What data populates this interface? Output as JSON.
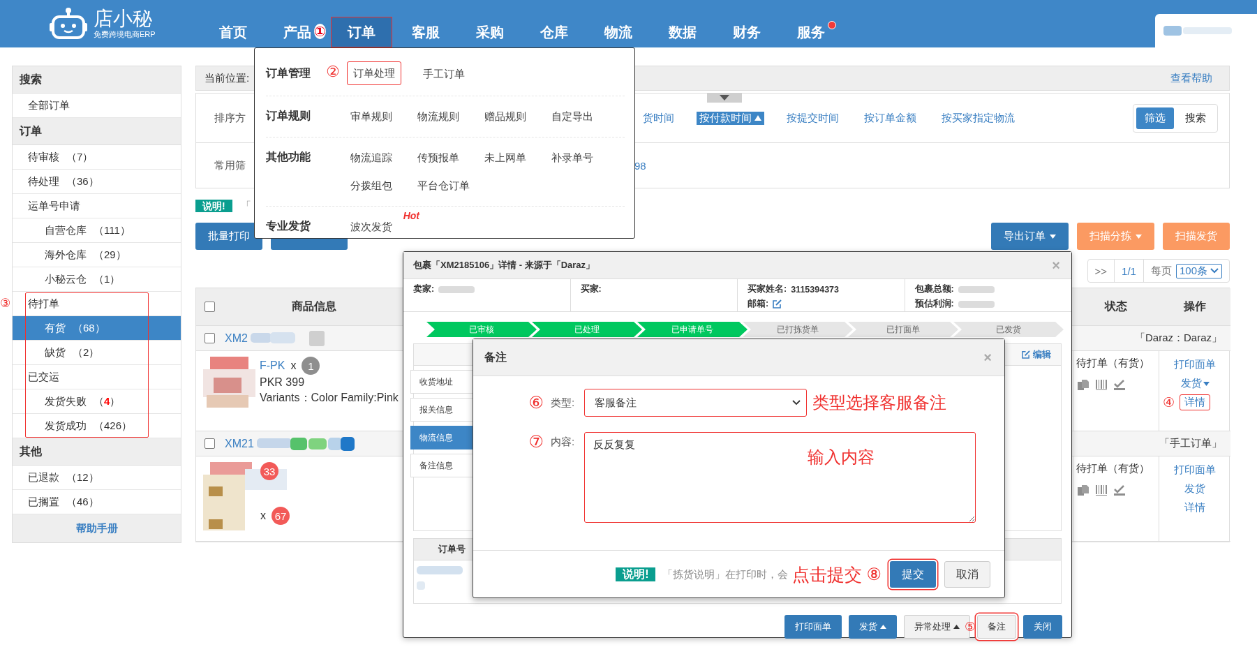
{
  "header": {
    "logo": {
      "name": "店小秘",
      "tagline": "免费跨境电商ERP"
    },
    "nav": [
      {
        "label": "首页",
        "selected": false,
        "highlighted": false,
        "notify": false
      },
      {
        "label": "产品",
        "selected": false,
        "highlighted": false,
        "notify": false
      },
      {
        "label": "订单",
        "selected": true,
        "highlighted": true,
        "notify": false,
        "marker": "①"
      },
      {
        "label": "客服",
        "selected": false,
        "highlighted": false,
        "notify": false
      },
      {
        "label": "采购",
        "selected": false,
        "highlighted": false,
        "notify": false
      },
      {
        "label": "仓库",
        "selected": false,
        "highlighted": false,
        "notify": false
      },
      {
        "label": "物流",
        "selected": false,
        "highlighted": false,
        "notify": false
      },
      {
        "label": "数据",
        "selected": false,
        "highlighted": false,
        "notify": false
      },
      {
        "label": "财务",
        "selected": false,
        "highlighted": false,
        "notify": false
      },
      {
        "label": "服务",
        "selected": false,
        "highlighted": false,
        "notify": true
      }
    ]
  },
  "menu": {
    "sections": [
      {
        "title": "订单管理",
        "links": [
          {
            "label": "订单处理",
            "highlighted": true,
            "marker": "②"
          },
          {
            "label": "手工订单",
            "highlighted": false
          }
        ]
      },
      {
        "title": "订单规则",
        "links": [
          {
            "label": "审单规则",
            "highlighted": false
          },
          {
            "label": "物流规则",
            "highlighted": false
          },
          {
            "label": "赠品规则",
            "highlighted": false
          },
          {
            "label": "自定导出",
            "highlighted": false
          }
        ]
      },
      {
        "title": "其他功能",
        "links": [
          {
            "label": "物流追踪",
            "highlighted": false
          },
          {
            "label": "传预报单",
            "highlighted": false
          },
          {
            "label": "未上网单",
            "highlighted": false
          },
          {
            "label": "补录单号",
            "highlighted": false
          },
          {
            "label": "分拨组包",
            "highlighted": false
          },
          {
            "label": "平台仓订单",
            "highlighted": false
          }
        ]
      },
      {
        "title": "专业发货",
        "links": [
          {
            "label": "波次发货",
            "highlighted": false,
            "tag": "Hot"
          }
        ]
      }
    ]
  },
  "sidebar": {
    "sections": [
      {
        "title": "搜索",
        "items": [
          {
            "kind": "entry",
            "label": "全部订单",
            "selected": false
          }
        ]
      },
      {
        "title": "订单",
        "items": [
          {
            "kind": "entry",
            "label": "待审核",
            "count": "（7）",
            "alert": false,
            "selected": false
          },
          {
            "kind": "entry",
            "label": "待处理",
            "count": "（36）",
            "alert": false,
            "selected": false
          },
          {
            "kind": "entry",
            "label": "运单号申请",
            "selected": false,
            "children": [
              {
                "kind": "entry",
                "label": "自营仓库",
                "count": "（111）",
                "alert": false,
                "selected": false
              },
              {
                "kind": "entry",
                "label": "海外仓库",
                "count": "（29）",
                "alert": false,
                "selected": false
              },
              {
                "kind": "entry",
                "label": "小秘云仓",
                "count": "（1）",
                "alert": false,
                "selected": false
              }
            ]
          },
          {
            "kind": "annotation",
            "marker": "③",
            "items": [
              {
                "kind": "entry",
                "label": "待打单",
                "selected": false,
                "children": [
                  {
                    "kind": "entry",
                    "label": "有货",
                    "count": "（68）",
                    "alert": false,
                    "selected": true
                  },
                  {
                    "kind": "entry",
                    "label": "缺货",
                    "count": "（2）",
                    "alert": false,
                    "selected": false
                  }
                ]
              },
              {
                "kind": "entry",
                "label": "已交运",
                "selected": false,
                "children": [
                  {
                    "kind": "entry",
                    "label": "发货失败",
                    "count": "（4）",
                    "alert": true,
                    "selected": false
                  },
                  {
                    "kind": "entry",
                    "label": "发货成功",
                    "count": "（426）",
                    "alert": false,
                    "selected": false
                  }
                ]
              }
            ]
          }
        ]
      },
      {
        "title": "其他",
        "items": [
          {
            "kind": "entry",
            "label": "已退款",
            "count": "（12）",
            "alert": false,
            "selected": false
          },
          {
            "kind": "entry",
            "label": "已搁置",
            "count": "（46）",
            "alert": false,
            "selected": false
          }
        ]
      }
    ],
    "footer": "帮助手册"
  },
  "content": {
    "breadcrumb": "当前位置:",
    "help": "查看帮助",
    "sort_label": "排序方",
    "sort_options": [
      {
        "label": "货时间",
        "selected": false
      },
      {
        "label": "按付款时间",
        "selected": true
      },
      {
        "label": "按提交时间",
        "selected": false
      },
      {
        "label": "按订单金额",
        "selected": false
      },
      {
        "label": "按买家指定物流",
        "selected": false
      }
    ],
    "view_toggle": [
      {
        "label": "筛选",
        "selected": true
      },
      {
        "label": "搜索",
        "selected": false
      }
    ],
    "filter_label": "常用筛",
    "filter_value": "98",
    "notice_label": "说明!",
    "notice_text": "「",
    "left_buttons": [
      {
        "label": "批量打印"
      }
    ],
    "right_buttons": [
      {
        "label": "导出订单",
        "color": "#337ab7",
        "caret": true
      },
      {
        "label": "扫描分拣",
        "color": "#fb9a62",
        "caret": true
      },
      {
        "label": "扫描发货",
        "color": "#fb9a62",
        "caret": false
      }
    ],
    "pagination": {
      "next": ">>",
      "page": "1/1",
      "per_page_label": "每页",
      "per_page": "100条"
    }
  },
  "table": {
    "columns": [
      "商品信息",
      "状态",
      "操作"
    ],
    "all_checked": false,
    "orders": [
      {
        "number": "XM2",
        "checked": false,
        "source": "「Daraz：Daraz」",
        "status": "待打单（有货）",
        "products": [
          {
            "sku": "F-PK",
            "times": "x",
            "qty": "1",
            "color": "#8e8e8e",
            "price": "PKR 399",
            "variants": "Variants：Color Family:Pink"
          }
        ],
        "actions": [
          {
            "label": "打印面单",
            "caret": false,
            "highlighted": false
          },
          {
            "label": "发货",
            "caret": true,
            "highlighted": false
          },
          {
            "label": "详情",
            "caret": false,
            "highlighted": true,
            "marker": "④"
          }
        ]
      },
      {
        "number": "XM21",
        "checked": false,
        "source": "「手工订单」",
        "status": "待打单（有货）",
        "products": [
          {
            "qty": "33",
            "color": "#f25a58"
          },
          {
            "times": "x",
            "qty": "67",
            "color": "#f25a58"
          }
        ],
        "actions": [
          {
            "label": "打印面单",
            "caret": false,
            "highlighted": false
          },
          {
            "label": "发货",
            "caret": false,
            "highlighted": false
          },
          {
            "label": "详情",
            "caret": false,
            "highlighted": false
          }
        ]
      }
    ]
  },
  "detail": {
    "title": "包裹「XM2185106」详情 - 来源于「Daraz」",
    "close": "×",
    "info": [
      [
        {
          "label": "卖家:",
          "kind": "blurred"
        }
      ],
      [
        {
          "label": "买家:",
          "kind": "plain"
        }
      ],
      [
        {
          "label": "买家姓名:",
          "kind": "value",
          "value": "3115394373"
        },
        {
          "label": "邮箱:",
          "kind": "edit"
        }
      ],
      [
        {
          "label": "包裹总额:",
          "kind": "blurred"
        },
        {
          "label": "预估利润:",
          "kind": "blurred"
        }
      ]
    ],
    "steps": [
      {
        "label": "已审核",
        "done": true
      },
      {
        "label": "已处理",
        "done": true
      },
      {
        "label": "已申请单号",
        "done": true
      },
      {
        "label": "已打拣货单",
        "done": false
      },
      {
        "label": "已打面单",
        "done": false
      },
      {
        "label": "已发货",
        "done": false
      }
    ],
    "tabs": [
      {
        "label": "收货地址",
        "selected": false
      },
      {
        "label": "报关信息",
        "selected": false
      },
      {
        "label": "物流信息",
        "selected": true
      },
      {
        "label": "备注信息",
        "selected": false
      }
    ],
    "edit_link": "编辑",
    "table_header": "订单号",
    "buttons": [
      {
        "label": "打印面单",
        "kind": "primary",
        "caret": false,
        "highlighted": false
      },
      {
        "label": "发货",
        "kind": "primary",
        "caret": true,
        "highlighted": false
      },
      {
        "label": "异常处理",
        "kind": "default",
        "caret": true,
        "highlighted": false
      },
      {
        "label": "备注",
        "kind": "default",
        "caret": false,
        "highlighted": true,
        "marker": "⑤"
      },
      {
        "label": "关闭",
        "kind": "primary",
        "caret": false,
        "highlighted": false
      }
    ]
  },
  "remark": {
    "title": "备注",
    "close": "×",
    "type": {
      "marker": "⑥",
      "label": "类型:",
      "value": "客服备注",
      "note": "类型选择客服备注"
    },
    "content": {
      "marker": "⑦",
      "label": "内容:",
      "value": "反反复复",
      "note": "输入内容"
    },
    "notice_label": "说明!",
    "notice_text": "「拣货说明」在打印时，会",
    "submit_note": "点击提交",
    "submit_marker": "⑧",
    "buttons": [
      {
        "label": "提交",
        "kind": "primary",
        "highlighted": true
      },
      {
        "label": "取消",
        "kind": "default",
        "highlighted": false
      }
    ]
  }
}
